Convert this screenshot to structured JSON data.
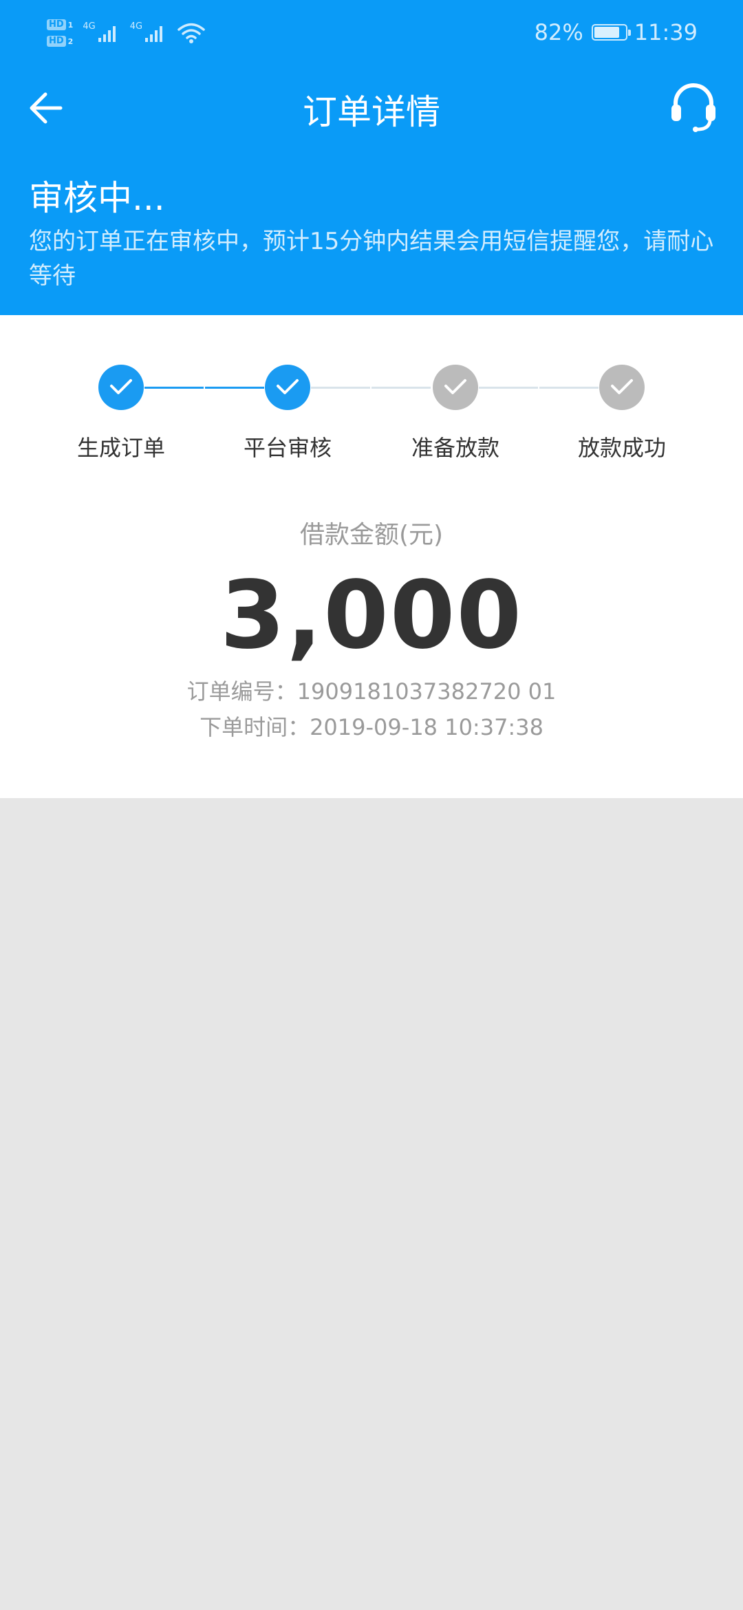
{
  "status_bar": {
    "hd1": "HD",
    "hd1_num": "1",
    "hd2": "HD",
    "hd2_num": "2",
    "net1": "4G",
    "net2": "4G",
    "battery_percent_text": "82%",
    "battery_level": 0.82,
    "time": "11:39"
  },
  "nav": {
    "title": "订单详情",
    "back_icon": "arrow-left-icon",
    "service_icon": "headset-icon"
  },
  "review": {
    "title": "审核中...",
    "description": "您的订单正在审核中，预计15分钟内结果会用短信提醒您，请耐心等待"
  },
  "steps": [
    {
      "label": "生成订单",
      "done": true
    },
    {
      "label": "平台审核",
      "done": true
    },
    {
      "label": "准备放款",
      "done": false
    },
    {
      "label": "放款成功",
      "done": false
    }
  ],
  "loan": {
    "amount_label": "借款金额(元)",
    "amount": "3,000",
    "order_no": "订单编号：1909181037382720 01",
    "order_time": "下单时间：2019-09-18 10:37:38"
  },
  "colors": {
    "primary": "#0a9bf7",
    "step_done": "#1a9bf2",
    "step_pending": "#bbbbbb",
    "line_pending": "#d9e3ea",
    "background": "#e6e6e6"
  }
}
